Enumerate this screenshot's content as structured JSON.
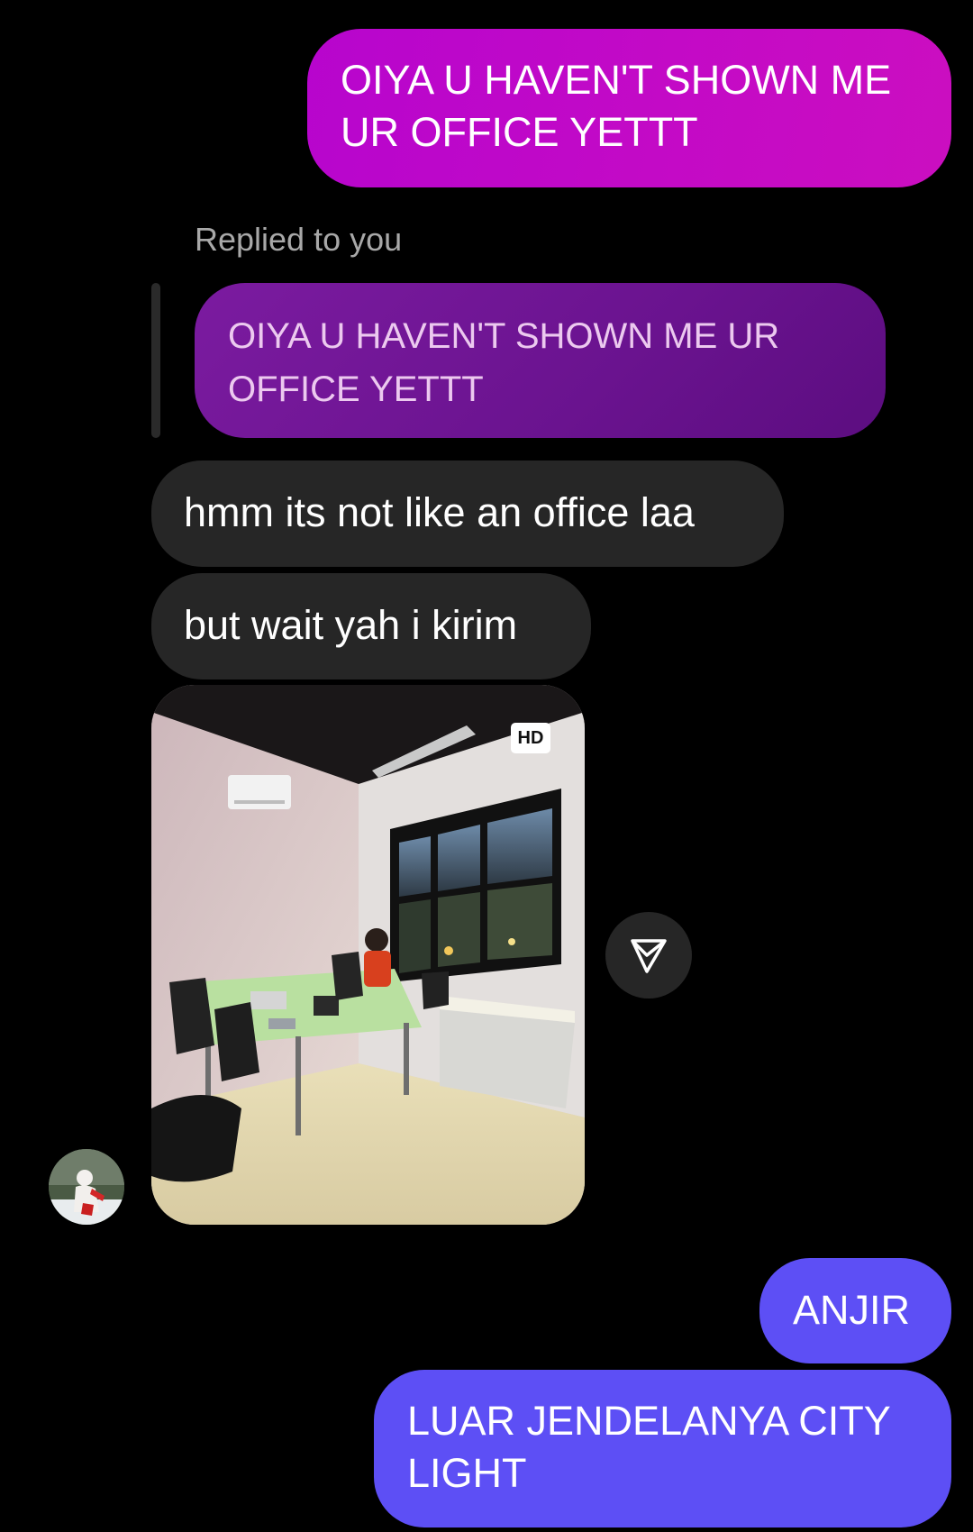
{
  "colors": {
    "background": "#000000",
    "sent_gradient": "#c10ac7",
    "sent_blue": "#5d4ff5",
    "received_bubble": "#262626",
    "quoted_bubble": "#6a138f"
  },
  "messages": {
    "sent_top": {
      "line1": "OIYA U HAVEN'T SHOWN ME",
      "line2": "UR OFFICE YETTT"
    },
    "reply": {
      "label": "Replied to you",
      "quoted_line1": "OIYA U HAVEN'T SHOWN ME UR",
      "quoted_line2": "OFFICE YETTT"
    },
    "received": [
      {
        "text": "hmm its not like an office laa"
      },
      {
        "text": "but wait yah i kirim"
      }
    ],
    "photo": {
      "badge": "HD",
      "description_icon": "photo-of-office-room"
    },
    "share_icon": "send-paper-plane-icon",
    "avatar_icon": "contact-avatar",
    "sent_bottom": [
      {
        "line1": "ANJIR"
      },
      {
        "line1": "LUAR JENDELANYA CITY",
        "line2": "LIGHT"
      }
    ]
  }
}
